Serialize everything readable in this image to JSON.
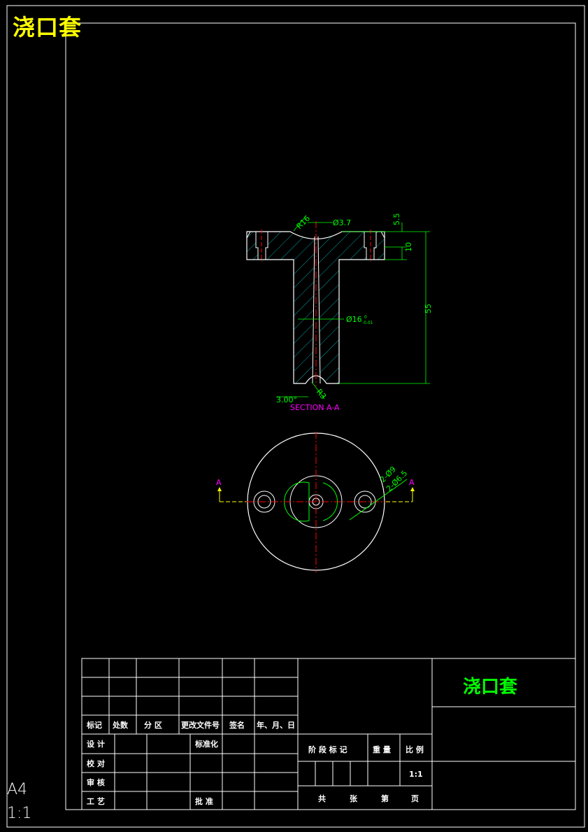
{
  "drawing": {
    "title": "浇口套",
    "paper_size": "A4",
    "scale": "1:1",
    "section_label": "SECTION A-A",
    "section_marker": "A"
  },
  "dimensions": {
    "radius_top": "R16",
    "diameter_hole": "Ø3.7",
    "flange_gap": "5.5",
    "flange_thickness": "10",
    "total_length": "55",
    "stem_diameter": "Ø16",
    "stem_tol_upper": "0",
    "stem_tol_lower": "-0.01",
    "radius_bottom": "R3",
    "angle": "3.00°",
    "holes_9": "2-Ø9",
    "holes_65": "2-Ø6.5"
  },
  "title_block": {
    "headers": [
      "标记",
      "处数",
      "分 区",
      "更改文件号",
      "签名",
      "年、月、日"
    ],
    "left_rows": [
      "设 计",
      "校 对",
      "审 核",
      "工 艺"
    ],
    "standardize": "标准化",
    "approve": "批 准",
    "stage_mark": "阶 段 标 记",
    "weight": "重 量",
    "ratio": "比 例",
    "ratio_value": "1:1",
    "total": "共",
    "sheets": "张",
    "sheet_no": "第",
    "page": "页",
    "part_name": "浇口套"
  },
  "colors": {
    "outline": "#ffffff",
    "dimension": "#00ff00",
    "centerline": "#ff0000",
    "hatch": "#00cccc",
    "title": "#ffff00",
    "section": "#ff00ff"
  }
}
